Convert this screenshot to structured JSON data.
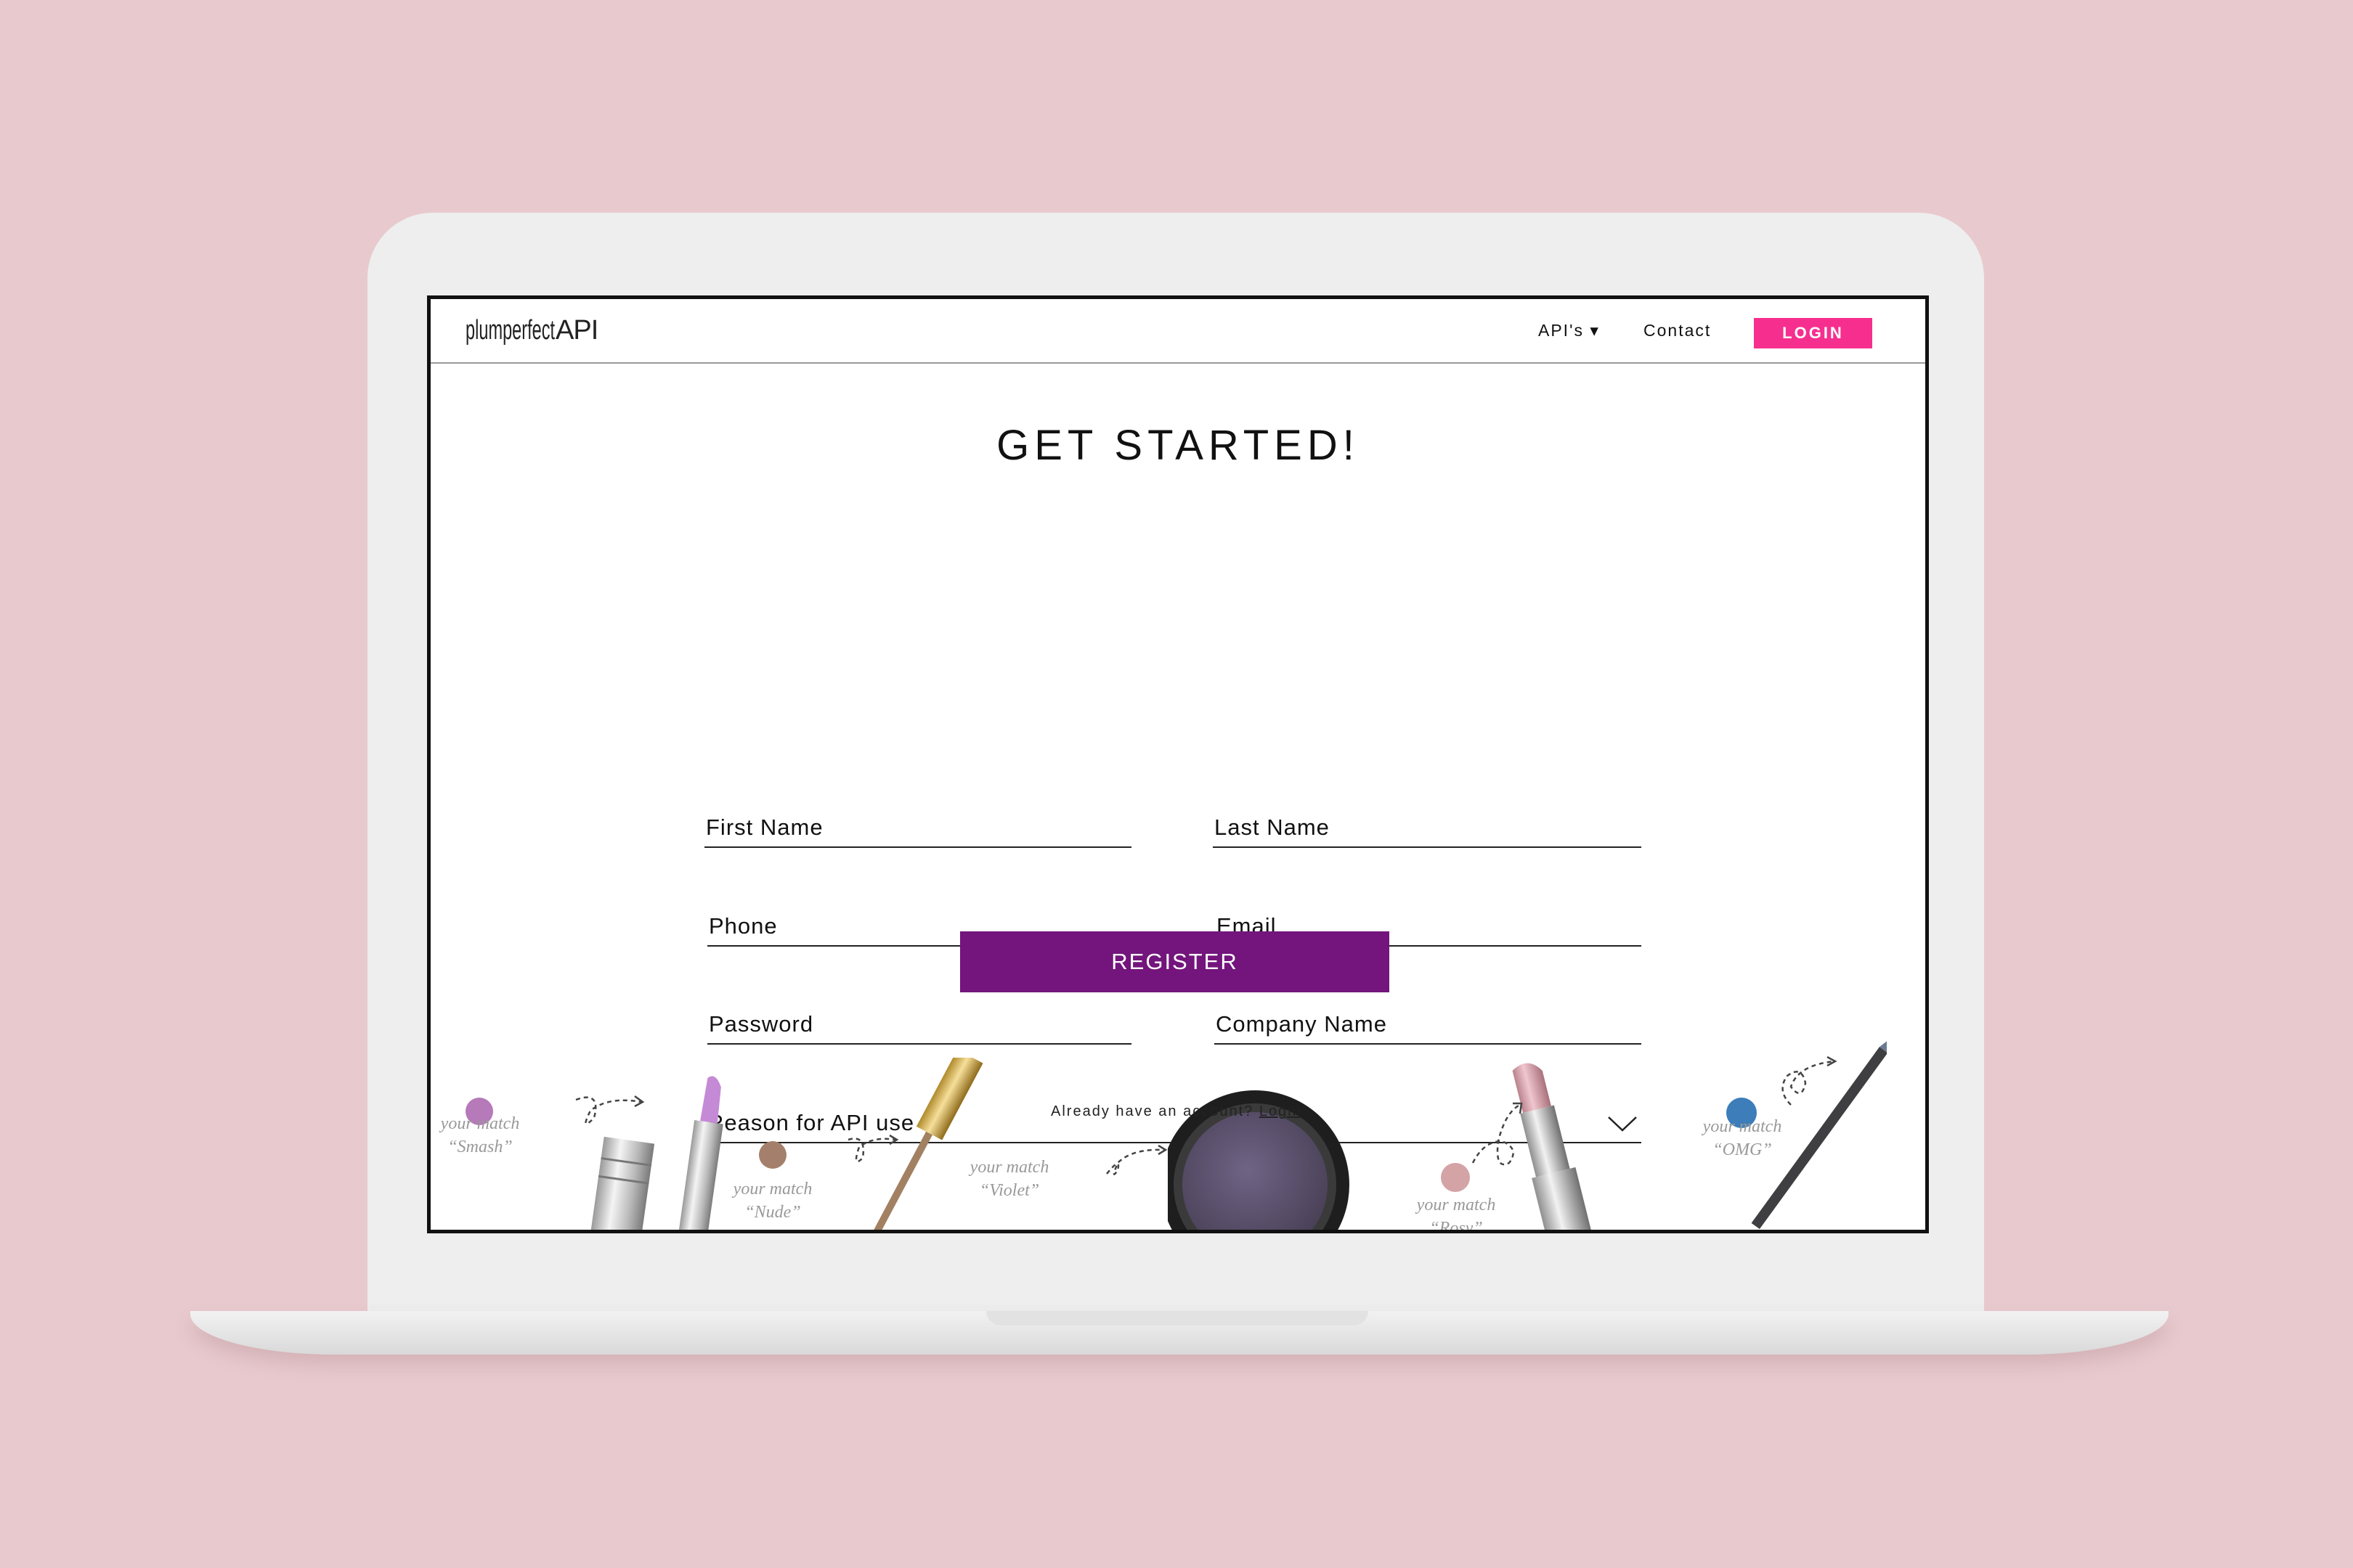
{
  "nav": {
    "logo_plum_perfect": "plumperfect",
    "logo_api": "API",
    "apis_label": "API's ▾",
    "contact_label": "Contact",
    "login_label": "LOGIN"
  },
  "form": {
    "title": "GET STARTED!",
    "first_name": "First Name",
    "last_name": "Last Name",
    "phone": "Phone",
    "email": "Email",
    "password": "Password",
    "company_name": "Company Name",
    "reason": "Reason for API use",
    "register_label": "REGISTER",
    "already_text": "Already have an account?",
    "login_link": "Login"
  },
  "matches": [
    {
      "line1": "your match",
      "line2": "“Smash”",
      "color": "#b679b9"
    },
    {
      "line1": "your match",
      "line2": "“Nude”",
      "color": "#a4806c"
    },
    {
      "line1": "your match",
      "line2": "“Violet”",
      "color": "#5b5068"
    },
    {
      "line1": "your match",
      "line2": "“Rosy”",
      "color": "#d4a3a6"
    },
    {
      "line1": "your match",
      "line2": "“OMG”",
      "color": "#3c7dba"
    }
  ],
  "colors": {
    "background": "#e8cace",
    "login_button": "#f62f8f",
    "register_button": "#73157c"
  }
}
